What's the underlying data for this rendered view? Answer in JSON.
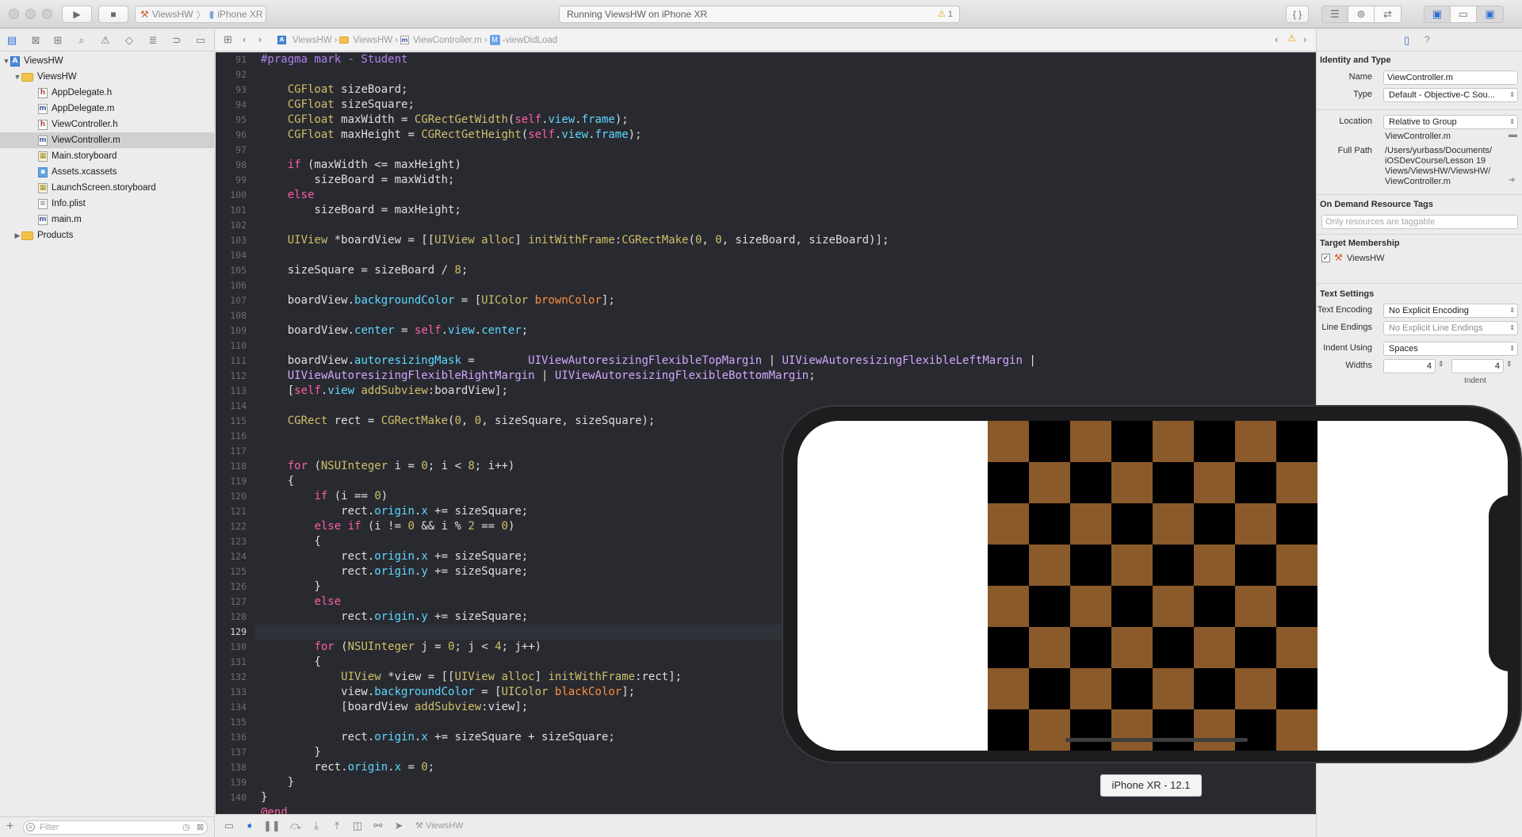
{
  "toolbar": {
    "scheme_name": "ViewsHW",
    "device_name": "iPhone XR",
    "status_text": "Running ViewsHW on iPhone XR",
    "warning_count": "1"
  },
  "jumpbar": {
    "crumbs": [
      "ViewsHW",
      "ViewsHW",
      "ViewController.m",
      "-viewDidLoad"
    ]
  },
  "navigator": {
    "items": [
      {
        "label": "ViewsHW",
        "kind": "project"
      },
      {
        "label": "ViewsHW",
        "kind": "folder"
      },
      {
        "label": "AppDelegate.h",
        "kind": "h"
      },
      {
        "label": "AppDelegate.m",
        "kind": "m"
      },
      {
        "label": "ViewController.h",
        "kind": "h"
      },
      {
        "label": "ViewController.m",
        "kind": "m",
        "selected": true
      },
      {
        "label": "Main.storyboard",
        "kind": "storyboard"
      },
      {
        "label": "Assets.xcassets",
        "kind": "assets"
      },
      {
        "label": "LaunchScreen.storyboard",
        "kind": "storyboard"
      },
      {
        "label": "Info.plist",
        "kind": "plist"
      },
      {
        "label": "main.m",
        "kind": "m"
      },
      {
        "label": "Products",
        "kind": "folder"
      }
    ],
    "filter_placeholder": "Filter"
  },
  "editor": {
    "line_numbers": [
      91,
      92,
      93,
      94,
      95,
      96,
      97,
      98,
      99,
      100,
      101,
      102,
      103,
      104,
      105,
      106,
      107,
      108,
      109,
      110,
      111,
      112,
      113,
      114,
      115,
      116,
      117,
      118,
      119,
      120,
      121,
      122,
      123,
      124,
      125,
      126,
      127,
      128,
      129,
      130,
      131,
      132,
      133,
      134,
      135,
      136,
      137,
      138,
      139,
      140
    ],
    "current_line": 129
  },
  "debugbar": {
    "target_label": "ViewsHW"
  },
  "inspector": {
    "identity_title": "Identity and Type",
    "name_label": "Name",
    "name_value": "ViewController.m",
    "type_label": "Type",
    "type_value": "Default - Objective-C Sou...",
    "location_label": "Location",
    "location_value": "Relative to Group",
    "location_file": "ViewController.m",
    "fullpath_label": "Full Path",
    "fullpath_lines": [
      "/Users/yurbass/Documents/",
      "iOSDevCourse/Lesson 19",
      "Views/ViewsHW/ViewsHW/",
      "ViewController.m"
    ],
    "odr_title": "On Demand Resource Tags",
    "odr_placeholder": "Only resources are taggable",
    "target_title": "Target Membership",
    "target_item": "ViewsHW",
    "text_title": "Text Settings",
    "encoding_label": "Text Encoding",
    "encoding_value": "No Explicit Encoding",
    "line_endings_label": "Line Endings",
    "line_endings_value": "No Explicit Line Endings",
    "indent_label": "Indent Using",
    "indent_value": "Spaces",
    "widths_label": "Widths",
    "width_tab": "4",
    "width_indent": "4",
    "indent_sublabel": "Indent"
  },
  "simulator": {
    "label": "iPhone XR - 12.1",
    "board": {
      "rows": 8,
      "cols": 8,
      "light_color": "#8b5a2b",
      "dark_color": "#000000"
    }
  },
  "colors": {
    "editor_bg": "#292a30",
    "keyword": "#fc5fa3",
    "type": "#d0bf69",
    "property": "#5dd8ff",
    "method": "#a167e6",
    "class": "#d0a8ff",
    "number": "#d0bf69"
  }
}
